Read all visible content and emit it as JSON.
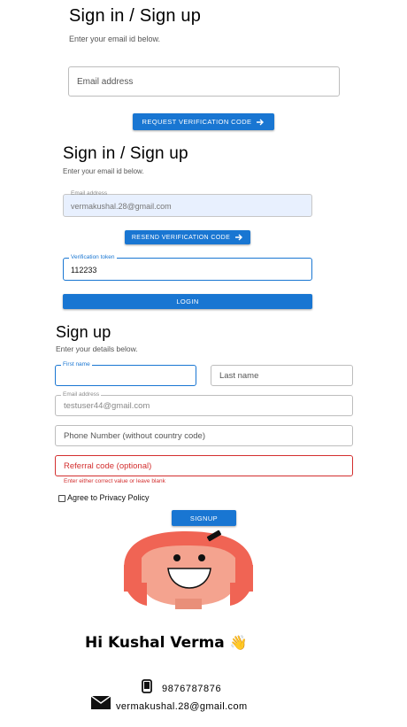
{
  "panel1": {
    "title": "Sign in / Sign up",
    "subtitle": "Enter your email id below.",
    "email_placeholder": "Email address",
    "request_button": "REQUEST VERIFICATION CODE"
  },
  "panel2": {
    "title": "Sign in / Sign up",
    "subtitle": "Enter your email id below.",
    "email_label": "Email address",
    "email_value": "vermakushal.28@gmail.com",
    "resend_button": "RESEND VERIFICATION CODE",
    "token_label": "Verification token",
    "token_value": "112233",
    "login_button": "LOGIN"
  },
  "panel3": {
    "title": "Sign up",
    "subtitle": "Enter your details below.",
    "first_name_label": "First name",
    "last_name_placeholder": "Last name",
    "email_label": "Email address",
    "email_value": "testuser44@gmail.com",
    "phone_placeholder": "Phone Number (without country code)",
    "referral_placeholder": "Referral code (optional)",
    "referral_helper": "Enter either correct value or leave blank",
    "privacy_label": "Agree to Privacy Policy",
    "signup_button": "SIGNUP"
  },
  "profile": {
    "greeting": "Hi Kushal Verma",
    "wave_emoji": "👋",
    "phone": "9876787876",
    "email": "vermakushal.28@gmail.com",
    "phone_icon": "mobile-phone-icon",
    "email_icon": "envelope-icon"
  },
  "colors": {
    "primary": "#1976d2",
    "error": "#d32f2f",
    "disabled_fill": "#e8f0fe",
    "avatar_hair": "#f06454",
    "avatar_skin": "#f4a38f"
  }
}
